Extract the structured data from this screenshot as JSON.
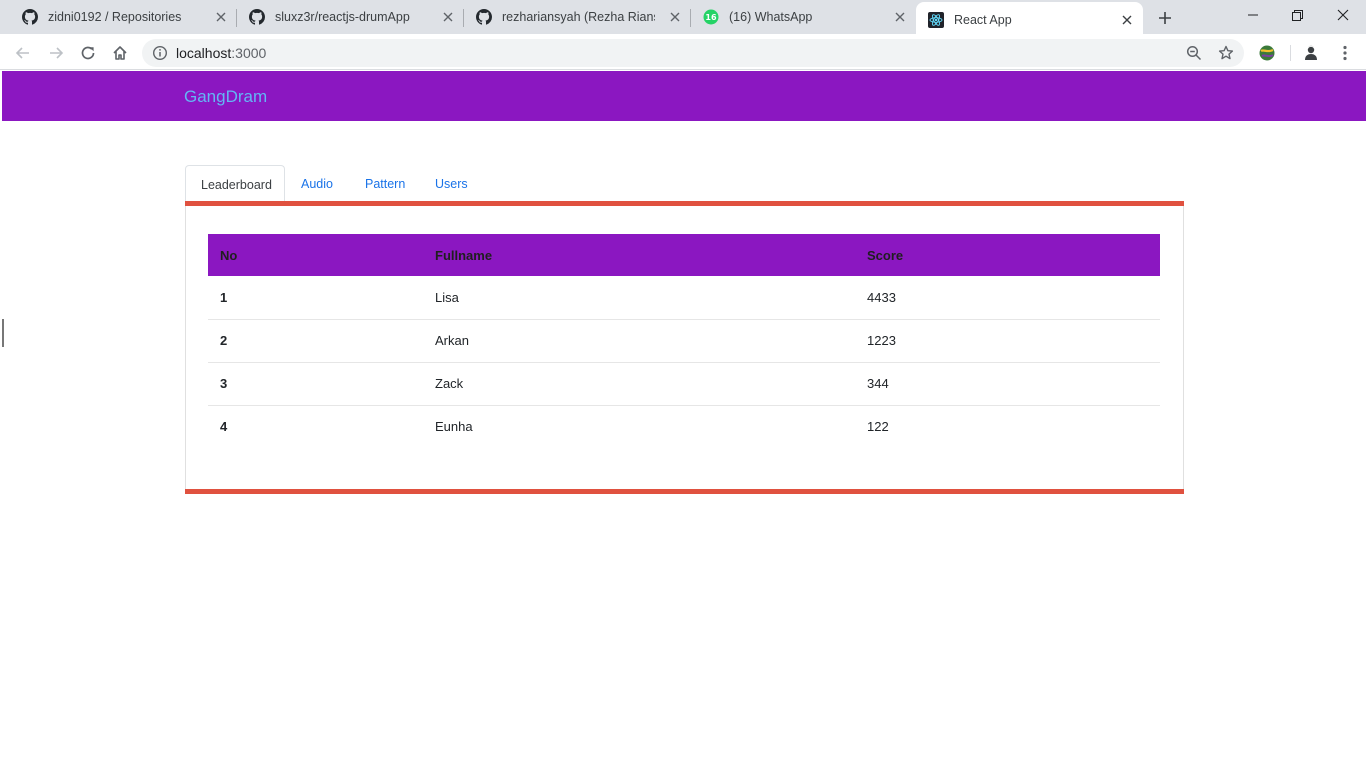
{
  "browser": {
    "tabs": [
      {
        "title": "zidni0192 / Repositories",
        "icon": "github-icon"
      },
      {
        "title": "sluxz3r/reactjs-drumApp",
        "icon": "github-icon"
      },
      {
        "title": "rezhariansyah (Rezha Riansyah",
        "icon": "github-icon"
      },
      {
        "title": "(16) WhatsApp",
        "icon": "whatsapp-icon",
        "badge": "16"
      },
      {
        "title": "React App",
        "icon": "react-icon",
        "active": true
      }
    ],
    "address": {
      "host": "localhost",
      "port": ":3000"
    }
  },
  "app": {
    "brand": "GangDram",
    "nav_tabs": [
      {
        "label": "Leaderboard",
        "active": true
      },
      {
        "label": "Audio"
      },
      {
        "label": "Pattern"
      },
      {
        "label": "Users"
      }
    ],
    "table": {
      "headers": {
        "no": "No",
        "fullname": "Fullname",
        "score": "Score"
      },
      "rows": [
        {
          "no": "1",
          "fullname": "Lisa",
          "score": "4433"
        },
        {
          "no": "2",
          "fullname": "Arkan",
          "score": "1223"
        },
        {
          "no": "3",
          "fullname": "Zack",
          "score": "344"
        },
        {
          "no": "4",
          "fullname": "Eunha",
          "score": "122"
        }
      ]
    }
  },
  "colors": {
    "navbar": "#8b17c1",
    "brand_text": "#63b6f5",
    "card_accent": "#e0513f",
    "tab_link": "#1a73e8"
  }
}
